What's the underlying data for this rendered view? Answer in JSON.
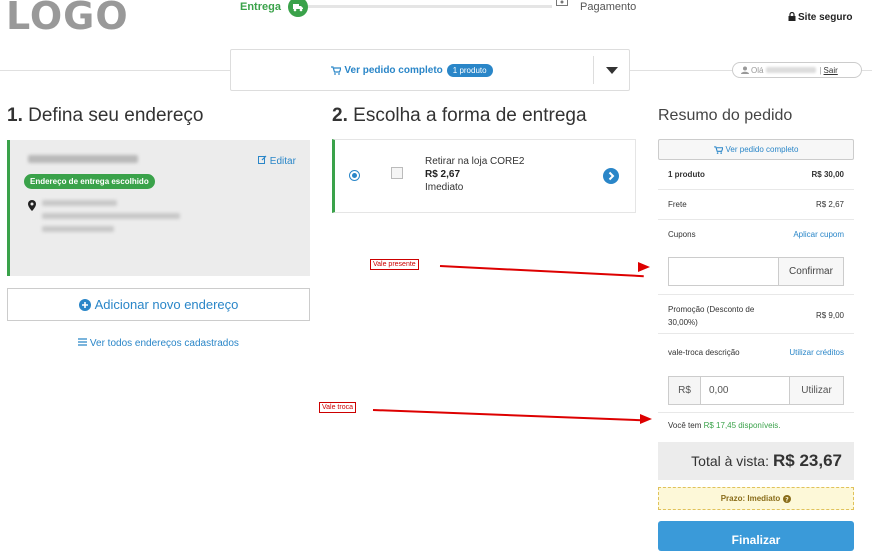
{
  "header": {
    "logo": "LOGO",
    "steps": [
      {
        "label": "Entrega"
      },
      {
        "label": "Pagamento"
      }
    ],
    "secure_label": "Site seguro",
    "order_bar_label": "Ver pedido completo",
    "order_bar_badge": "1 produto",
    "greeting": "Olá",
    "logout": "Sair"
  },
  "address": {
    "number": "1.",
    "title": "Defina seu endereço",
    "edit_label": "Editar",
    "chosen_badge": "Endereço de entrega escolhido",
    "add_label": "Adicionar novo endereço",
    "all_label": "Ver todos endereços cadastrados"
  },
  "delivery": {
    "number": "2.",
    "title": "Escolha a forma de entrega",
    "option_name": "Retirar na loja CORE2",
    "option_price": "R$ 2,67",
    "option_time": "Imediato"
  },
  "annotations": {
    "vale_presente": "Vale presente",
    "vale_troca": "Vale troca"
  },
  "summary": {
    "title": "Resumo do pedido",
    "view_order": "Ver pedido completo",
    "rows": {
      "products_label": "1 produto",
      "products_value": "R$ 30,00",
      "shipping_label": "Frete",
      "shipping_value": "R$ 2,67",
      "coupons_label": "Cupons",
      "coupons_link": "Aplicar cupom",
      "promo_label": "Promoção (Desconto de 30,00%)",
      "promo_value": "R$ 9,00",
      "voucher_label": "vale-troca descrição",
      "voucher_link": "Utilizar créditos"
    },
    "coupon_confirm": "Confirmar",
    "voucher_prefix": "R$",
    "voucher_value": "0,00",
    "voucher_use": "Utilizar",
    "available_prefix": "Você tem",
    "available_amount": "R$ 17,45 disponíveis.",
    "total_label": "Total à vista:",
    "total_value": "R$ 23,67",
    "prazo": "Prazo: Imediato",
    "finish": "Finalizar"
  },
  "colors": {
    "green": "#3aa24a",
    "blue": "#2a86c8",
    "red": "#d00"
  }
}
